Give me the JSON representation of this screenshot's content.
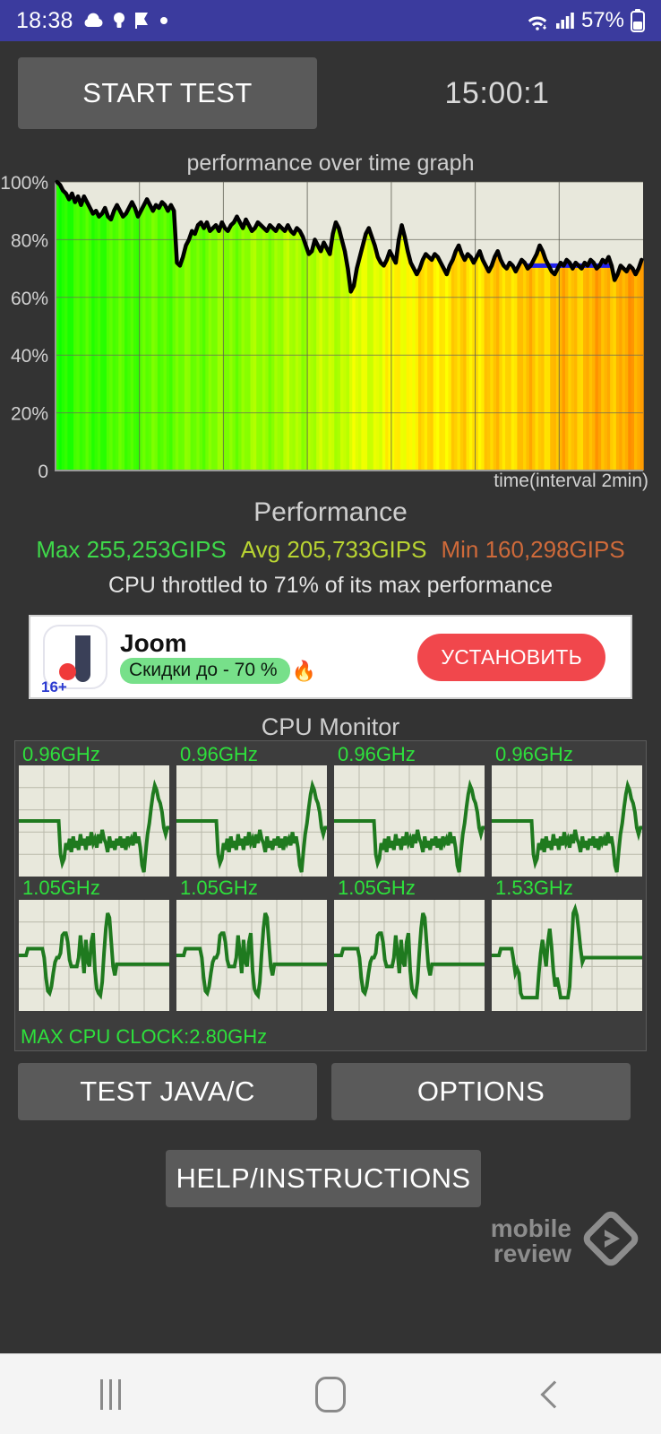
{
  "status_bar": {
    "time": "18:38",
    "battery_percent": "57%",
    "left_icons": [
      "cloud-icon",
      "lightbulb-icon",
      "checkmark-flag-icon",
      "dot-icon"
    ],
    "right_icons": [
      "wifi-icon",
      "cellular-signal-icon",
      "battery-icon"
    ],
    "background_color": "#3b3b9e"
  },
  "toolbar": {
    "start_test_label": "START TEST",
    "timer": "15:00:1"
  },
  "chart_data": {
    "type": "area",
    "title": "performance over time graph",
    "xlabel": "time(interval 2min)",
    "ylabel": "",
    "ylim": [
      0,
      100
    ],
    "yticks": [
      "0",
      "20%",
      "40%",
      "60%",
      "80%",
      "100%"
    ],
    "ytick_values": [
      0,
      20,
      40,
      60,
      80,
      100
    ],
    "grid": true,
    "marker_line_value": 71,
    "marker_line_color": "#2222ee",
    "series": [
      {
        "name": "performance %",
        "values": [
          100,
          99,
          97,
          96,
          94,
          96,
          93,
          95,
          92,
          95,
          93,
          91,
          89,
          90,
          88,
          89,
          91,
          88,
          87,
          90,
          92,
          90,
          88,
          89,
          91,
          93,
          91,
          88,
          90,
          92,
          94,
          92,
          90,
          92,
          91,
          93,
          92,
          90,
          92,
          90,
          72,
          71,
          74,
          78,
          80,
          83,
          82,
          85,
          86,
          84,
          86,
          83,
          84,
          85,
          83,
          86,
          84,
          83,
          85,
          86,
          88,
          86,
          84,
          87,
          85,
          83,
          84,
          86,
          85,
          84,
          83,
          85,
          84,
          83,
          85,
          84,
          83,
          85,
          83,
          82,
          84,
          83,
          81,
          78,
          75,
          76,
          80,
          78,
          76,
          79,
          77,
          75,
          82,
          86,
          84,
          80,
          76,
          70,
          62,
          64,
          70,
          74,
          78,
          82,
          84,
          81,
          78,
          74,
          72,
          71,
          73,
          76,
          74,
          72,
          80,
          85,
          81,
          76,
          72,
          70,
          68,
          70,
          73,
          75,
          74,
          73,
          75,
          74,
          72,
          70,
          68,
          71,
          73,
          76,
          78,
          75,
          73,
          75,
          74,
          72,
          74,
          76,
          73,
          71,
          69,
          71,
          74,
          76,
          73,
          71,
          70,
          72,
          71,
          69,
          71,
          73,
          72,
          70,
          71,
          73,
          75,
          78,
          76,
          73,
          71,
          69,
          68,
          70,
          72,
          71,
          73,
          72,
          70,
          72,
          71,
          70,
          72,
          71,
          73,
          72,
          70,
          71,
          73,
          72,
          74,
          71,
          66,
          68,
          71,
          70,
          69,
          71,
          70,
          68,
          70,
          73
        ]
      }
    ]
  },
  "performance": {
    "heading": "Performance",
    "max_label": "Max 255,253GIPS",
    "max_color": "#3fd94a",
    "avg_label": "Avg 205,733GIPS",
    "avg_color": "#b9d432",
    "min_label": "Min 160,298GIPS",
    "min_color": "#cf6a3a",
    "throttle_text": "CPU throttled to 71% of its max performance"
  },
  "ad": {
    "app_name": "Joom",
    "badge_text": "Скидки до - 70 %",
    "fire_emoji": "🔥",
    "install_label": "УСТАНОВИТЬ",
    "age_rating": "16+"
  },
  "cpu_monitor": {
    "heading": "CPU Monitor",
    "max_clock_text": "MAX CPU CLOCK:2.80GHz",
    "cores": [
      {
        "label": "0.96GHz",
        "points": [
          50,
          50,
          50,
          50,
          50,
          50,
          50,
          50,
          50,
          50,
          50,
          50,
          50,
          50,
          50,
          50,
          50,
          50,
          50,
          50,
          50,
          50,
          50,
          20,
          12,
          16,
          30,
          24,
          34,
          22,
          36,
          26,
          32,
          24,
          38,
          28,
          34,
          24,
          36,
          28,
          40,
          30,
          34,
          26,
          38,
          30,
          42,
          34,
          30,
          22,
          36,
          26,
          32,
          24,
          34,
          28,
          36,
          26,
          34,
          24,
          36,
          30,
          34,
          28,
          40,
          30,
          36,
          26,
          10,
          4,
          22,
          38,
          48,
          62,
          74,
          82,
          78,
          70,
          66,
          58,
          44,
          38,
          44,
          44
        ]
      },
      {
        "label": "0.96GHz",
        "points": [
          50,
          50,
          50,
          50,
          50,
          50,
          50,
          50,
          50,
          50,
          50,
          50,
          50,
          50,
          50,
          50,
          50,
          50,
          50,
          50,
          50,
          50,
          50,
          20,
          12,
          16,
          30,
          24,
          34,
          22,
          36,
          26,
          32,
          24,
          38,
          28,
          34,
          24,
          36,
          28,
          40,
          30,
          34,
          26,
          38,
          30,
          42,
          34,
          30,
          22,
          36,
          26,
          32,
          24,
          34,
          28,
          36,
          26,
          34,
          24,
          36,
          30,
          34,
          28,
          40,
          30,
          36,
          26,
          10,
          4,
          22,
          38,
          48,
          62,
          74,
          82,
          78,
          70,
          66,
          58,
          44,
          38,
          44,
          44
        ]
      },
      {
        "label": "0.96GHz",
        "points": [
          50,
          50,
          50,
          50,
          50,
          50,
          50,
          50,
          50,
          50,
          50,
          50,
          50,
          50,
          50,
          50,
          50,
          50,
          50,
          50,
          50,
          50,
          50,
          20,
          12,
          16,
          30,
          24,
          34,
          22,
          36,
          26,
          32,
          24,
          38,
          28,
          34,
          24,
          36,
          28,
          40,
          30,
          34,
          26,
          38,
          30,
          42,
          34,
          30,
          22,
          36,
          26,
          32,
          24,
          34,
          28,
          36,
          26,
          34,
          24,
          36,
          30,
          34,
          28,
          40,
          30,
          36,
          26,
          10,
          4,
          22,
          38,
          48,
          62,
          74,
          82,
          78,
          70,
          66,
          58,
          44,
          38,
          44,
          44
        ]
      },
      {
        "label": "0.96GHz",
        "points": [
          50,
          50,
          50,
          50,
          50,
          50,
          50,
          50,
          50,
          50,
          50,
          50,
          50,
          50,
          50,
          50,
          50,
          50,
          50,
          50,
          50,
          50,
          50,
          20,
          12,
          16,
          30,
          24,
          34,
          22,
          36,
          26,
          32,
          24,
          38,
          28,
          34,
          24,
          36,
          28,
          40,
          30,
          34,
          26,
          38,
          30,
          42,
          34,
          30,
          22,
          36,
          26,
          32,
          24,
          34,
          28,
          36,
          26,
          34,
          24,
          36,
          30,
          34,
          28,
          40,
          30,
          36,
          26,
          10,
          4,
          22,
          38,
          48,
          62,
          74,
          82,
          78,
          70,
          66,
          58,
          44,
          38,
          44,
          44
        ]
      },
      {
        "label": "1.05GHz",
        "points": [
          50,
          50,
          50,
          50,
          50,
          56,
          56,
          56,
          56,
          56,
          56,
          56,
          56,
          56,
          48,
          30,
          18,
          16,
          22,
          34,
          44,
          48,
          48,
          52,
          68,
          70,
          70,
          62,
          46,
          40,
          40,
          40,
          40,
          48,
          68,
          52,
          34,
          64,
          44,
          40,
          62,
          70,
          36,
          20,
          16,
          14,
          26,
          52,
          74,
          88,
          84,
          62,
          40,
          32,
          42,
          42,
          42,
          42,
          42,
          42,
          42,
          42,
          42,
          42,
          42,
          42,
          42,
          42,
          42,
          42,
          42,
          42,
          42,
          42,
          42,
          42,
          42,
          42,
          42,
          42,
          42,
          42,
          42,
          42
        ]
      },
      {
        "label": "1.05GHz",
        "points": [
          50,
          50,
          50,
          50,
          50,
          56,
          56,
          56,
          56,
          56,
          56,
          56,
          56,
          56,
          48,
          30,
          18,
          16,
          22,
          34,
          44,
          48,
          48,
          52,
          68,
          70,
          70,
          62,
          46,
          40,
          40,
          40,
          40,
          48,
          68,
          52,
          34,
          64,
          44,
          40,
          62,
          70,
          36,
          20,
          16,
          14,
          26,
          52,
          74,
          88,
          84,
          62,
          40,
          32,
          42,
          42,
          42,
          42,
          42,
          42,
          42,
          42,
          42,
          42,
          42,
          42,
          42,
          42,
          42,
          42,
          42,
          42,
          42,
          42,
          42,
          42,
          42,
          42,
          42,
          42,
          42,
          42,
          42,
          42
        ]
      },
      {
        "label": "1.05GHz",
        "points": [
          50,
          50,
          50,
          50,
          50,
          56,
          56,
          56,
          56,
          56,
          56,
          56,
          56,
          56,
          48,
          30,
          18,
          16,
          22,
          34,
          44,
          48,
          48,
          52,
          68,
          70,
          70,
          62,
          46,
          40,
          40,
          40,
          40,
          48,
          68,
          52,
          34,
          64,
          44,
          40,
          62,
          70,
          36,
          20,
          16,
          14,
          26,
          52,
          74,
          88,
          84,
          62,
          40,
          32,
          42,
          42,
          42,
          42,
          42,
          42,
          42,
          42,
          42,
          42,
          42,
          42,
          42,
          42,
          42,
          42,
          42,
          42,
          42,
          42,
          42,
          42,
          42,
          42,
          42,
          42,
          42,
          42,
          42,
          42
        ]
      },
      {
        "label": "1.53GHz",
        "points": [
          50,
          50,
          50,
          50,
          50,
          56,
          56,
          56,
          56,
          56,
          56,
          56,
          46,
          34,
          38,
          34,
          16,
          12,
          12,
          12,
          12,
          12,
          12,
          12,
          12,
          12,
          34,
          52,
          64,
          52,
          40,
          62,
          74,
          58,
          36,
          22,
          30,
          22,
          12,
          12,
          12,
          12,
          12,
          22,
          56,
          88,
          92,
          86,
          72,
          56,
          44,
          48,
          48,
          48,
          48,
          48,
          48,
          48,
          48,
          48,
          48,
          48,
          48,
          48,
          48,
          48,
          48,
          48,
          48,
          48,
          48,
          48,
          48,
          48,
          48,
          48,
          48,
          48,
          48,
          48,
          48,
          48,
          48,
          48
        ]
      }
    ],
    "plot_bg_color": "#e8e8dc",
    "line_color": "#1f7a1f",
    "label_color": "#2ee03c"
  },
  "bottom_buttons": {
    "test_java_c": "TEST JAVA/C",
    "options": "OPTIONS",
    "help": "HELP/INSTRUCTIONS"
  },
  "watermark": {
    "line1": "mobile",
    "line2": "review"
  },
  "nav_bar": {
    "recents": "recents-icon",
    "home": "home-icon",
    "back": "back-icon"
  }
}
